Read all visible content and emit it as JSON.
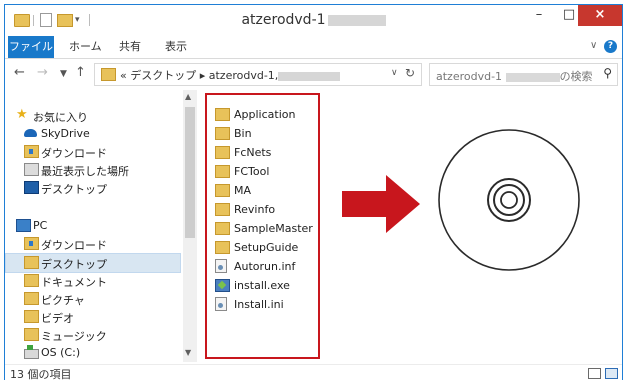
{
  "window": {
    "title": "atzerodvd-1",
    "controls": {
      "minimize": "–",
      "maximize": "□",
      "close": "×"
    }
  },
  "ribbon": {
    "tabs": [
      "ファイル",
      "ホーム",
      "共有",
      "表示"
    ],
    "expand_icon": "chevron-down",
    "help_label": "?"
  },
  "address": {
    "back": "←",
    "forward": "→",
    "dropdown": "▼",
    "up": "↑",
    "path_prefix": "«",
    "path": [
      "デスクトップ",
      "atzerodvd-1,"
    ],
    "refresh": "↻",
    "history": "∨"
  },
  "search": {
    "placeholder_start": "atzerodvd-1",
    "placeholder_end": "の検索",
    "icon": "search-icon"
  },
  "navpane": {
    "favorites": [
      "お気に入り",
      "SkyDrive",
      "ダウンロード",
      "最近表示した場所",
      "デスクトップ"
    ],
    "pc_label": "PC",
    "pc_items": [
      "ダウンロード",
      "デスクトップ",
      "ドキュメント",
      "ピクチャ",
      "ビデオ",
      "ミュージック",
      "OS (C:)"
    ],
    "selected": "デスクトップ"
  },
  "files": [
    {
      "name": "Application",
      "icon": "folder-icon"
    },
    {
      "name": "Bin",
      "icon": "folder-icon"
    },
    {
      "name": "FcNets",
      "icon": "folder-icon"
    },
    {
      "name": "FCTool",
      "icon": "folder-icon"
    },
    {
      "name": "MA",
      "icon": "folder-icon"
    },
    {
      "name": "Revinfo",
      "icon": "folder-icon"
    },
    {
      "name": "SampleMaster",
      "icon": "folder-icon"
    },
    {
      "name": "SetupGuide",
      "icon": "folder-icon"
    },
    {
      "name": "Autorun.inf",
      "icon": "settings-file-icon"
    },
    {
      "name": "install.exe",
      "icon": "installer-icon"
    },
    {
      "name": "Install.ini",
      "icon": "settings-file-icon"
    }
  ],
  "status": {
    "count": "13 個の項目"
  },
  "colors": {
    "accent": "#1979ca",
    "highlight_box": "#c8161d",
    "arrow": "#c8161d",
    "folder": "#e8c25a"
  }
}
